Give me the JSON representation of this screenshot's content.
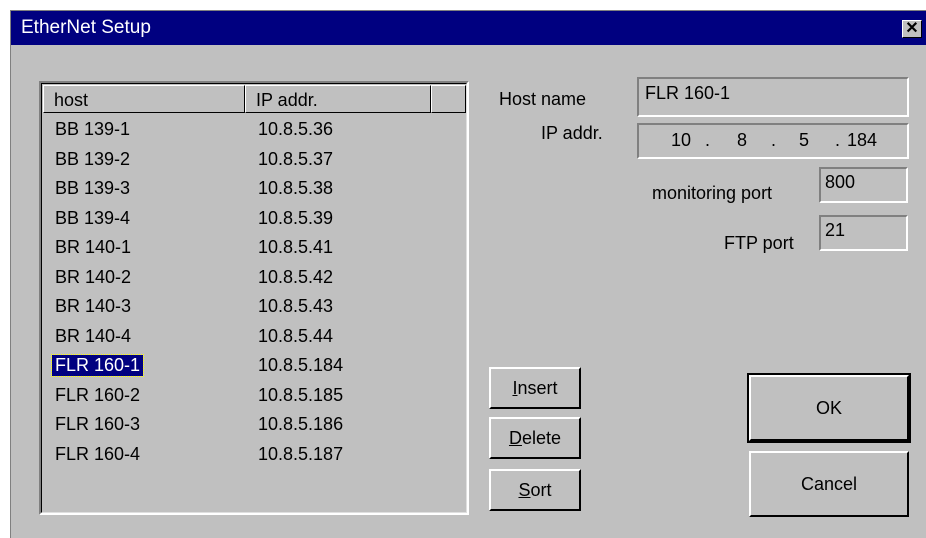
{
  "window": {
    "title": "EtherNet Setup",
    "close_glyph": "✕"
  },
  "list": {
    "columns": [
      "host",
      "IP addr."
    ],
    "rows": [
      {
        "host": "BB 139-1",
        "ip": "10.8.5.36"
      },
      {
        "host": "BB 139-2",
        "ip": "10.8.5.37"
      },
      {
        "host": "BB 139-3",
        "ip": "10.8.5.38"
      },
      {
        "host": "BB 139-4",
        "ip": "10.8.5.39"
      },
      {
        "host": "BR 140-1",
        "ip": "10.8.5.41"
      },
      {
        "host": "BR 140-2",
        "ip": "10.8.5.42"
      },
      {
        "host": "BR 140-3",
        "ip": "10.8.5.43"
      },
      {
        "host": "BR 140-4",
        "ip": "10.8.5.44"
      },
      {
        "host": "FLR 160-1",
        "ip": "10.8.5.184"
      },
      {
        "host": "FLR 160-2",
        "ip": "10.8.5.185"
      },
      {
        "host": "FLR 160-3",
        "ip": "10.8.5.186"
      },
      {
        "host": "FLR 160-4",
        "ip": "10.8.5.187"
      }
    ],
    "selected_index": 8
  },
  "form": {
    "host_name_label": "Host name",
    "host_name_value": "FLR 160-1",
    "ip_label": "IP addr.",
    "ip_octets": [
      "10",
      "8",
      "5",
      "184"
    ],
    "monitoring_port_label": "monitoring port",
    "monitoring_port_value": "800",
    "ftp_port_label": "FTP port",
    "ftp_port_value": "21"
  },
  "buttons": {
    "insert": {
      "mnemonic": "I",
      "rest": "nsert"
    },
    "delete": {
      "mnemonic": "D",
      "rest": "elete"
    },
    "sort": {
      "mnemonic": "S",
      "rest": "ort"
    },
    "ok": "OK",
    "cancel": "Cancel"
  }
}
